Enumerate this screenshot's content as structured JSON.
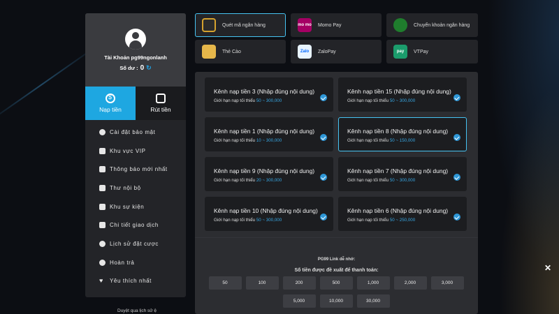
{
  "account": {
    "name": "Tài Khoản pg99ngonlanh",
    "balance_label": "Số dư :",
    "balance_value": "0"
  },
  "tabs": [
    {
      "label": "Nạp tiền",
      "icon": "dollar-icon",
      "active": true
    },
    {
      "label": "Rút tiền",
      "icon": "withdraw-icon",
      "active": false
    }
  ],
  "menu": [
    {
      "label": "Cài đặt bảo mật",
      "icon": "user-lock-icon"
    },
    {
      "label": "Khu vực VIP",
      "icon": "crown-icon"
    },
    {
      "label": "Thông báo mới nhất",
      "icon": "megaphone-icon"
    },
    {
      "label": "Thư nội bộ",
      "icon": "mail-icon"
    },
    {
      "label": "Khu sự kiện",
      "icon": "trophy-icon"
    },
    {
      "label": "Chi tiết giao dịch",
      "icon": "clipboard-icon"
    },
    {
      "label": "Lịch sử đặt cược",
      "icon": "history-icon"
    },
    {
      "label": "Hoàn trả",
      "icon": "refund-icon"
    },
    {
      "label": "Yêu thích nhất",
      "icon": "heart-icon"
    }
  ],
  "history_link": "Duyệt qua lịch sử ệ",
  "methods": [
    {
      "label": "Quét mã ngân hàng",
      "icon": "qr-icon",
      "active": true
    },
    {
      "label": "Momo Pay",
      "icon": "momo-icon",
      "badge": "mo mo"
    },
    {
      "label": "Chuyển khoản ngân hàng",
      "icon": "globe-icon"
    },
    {
      "label": "Thẻ Cào",
      "icon": "card-icon"
    },
    {
      "label": "ZaloPay",
      "icon": "zalopay-icon",
      "badge": "Zalo"
    },
    {
      "label": "VTPay",
      "icon": "vtpay-icon",
      "badge": "pay"
    }
  ],
  "channels": [
    {
      "title": "Kênh nạp tiền 3 (Nhập đúng nội dung)",
      "limit_label": "Giới hạn nạp tối thiểu",
      "range": "50 ~ 300,000",
      "active": false
    },
    {
      "title": "Kênh nạp tiền 15 (Nhập đúng nội dung)",
      "limit_label": "Giới hạn nạp tối thiểu",
      "range": "50 ~ 300,000",
      "active": false
    },
    {
      "title": "Kênh nạp tiền 1 (Nhập đúng nội dung)",
      "limit_label": "Giới hạn nạp tối thiểu",
      "range": "10 ~ 300,000",
      "active": false
    },
    {
      "title": "Kênh nạp tiền 8 (Nhập đúng nội dung)",
      "limit_label": "Giới hạn nạp tối thiểu",
      "range": "50 ~ 150,000",
      "active": true
    },
    {
      "title": "Kênh nạp tiền 9 (Nhập đúng nội dung)",
      "limit_label": "Giới hạn nạp tối thiểu",
      "range": "20 ~ 300,000",
      "active": false
    },
    {
      "title": "Kênh nạp tiền 7 (Nhập đúng nội dung)",
      "limit_label": "Giới hạn nạp tối thiểu",
      "range": "50 ~ 300,000",
      "active": false
    },
    {
      "title": "Kênh nạp tiền 10 (Nhập đúng nội dung)",
      "limit_label": "Giới hạn nạp tối thiểu",
      "range": "50 ~ 300,000",
      "active": false
    },
    {
      "title": "Kênh nạp tiền 6 (Nhập đúng nội dung)",
      "limit_label": "Giới hạn nạp tối thiểu",
      "range": "50 ~ 250,000",
      "active": false
    }
  ],
  "pg_link": "PG99 Link dễ nhớ:",
  "suggest_label": "Số tiền được đề xuất để thanh toán:",
  "amounts": [
    "50",
    "100",
    "200",
    "500",
    "1,000",
    "2,000",
    "3,000",
    "5,000",
    "10,000",
    "30,000"
  ],
  "close_glyph": "✕"
}
